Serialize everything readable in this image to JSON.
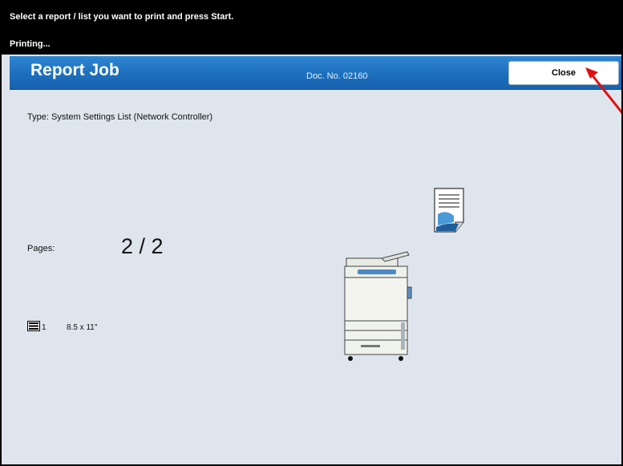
{
  "header": {
    "instruction": "Select a report / list you want to print and press Start.",
    "status": "Printing..."
  },
  "titlebar": {
    "title": "Report Job",
    "doc_no": "Doc. No. 02160",
    "close_label": "Close"
  },
  "job": {
    "type": "Type: System Settings List (Network Controller)",
    "pages_label": "Pages:",
    "pages_value": "2 / 2",
    "tray_number": "1",
    "paper_size": "8.5 x 11\""
  },
  "icons": {
    "tray": "paper-tray-icon",
    "document": "document-icon",
    "printer": "printer-illustration",
    "annotation": "red-arrow"
  },
  "colors": {
    "titlebar": "#1d6fbd",
    "background": "#dfe5ec",
    "annotation_arrow": "#e01010"
  }
}
